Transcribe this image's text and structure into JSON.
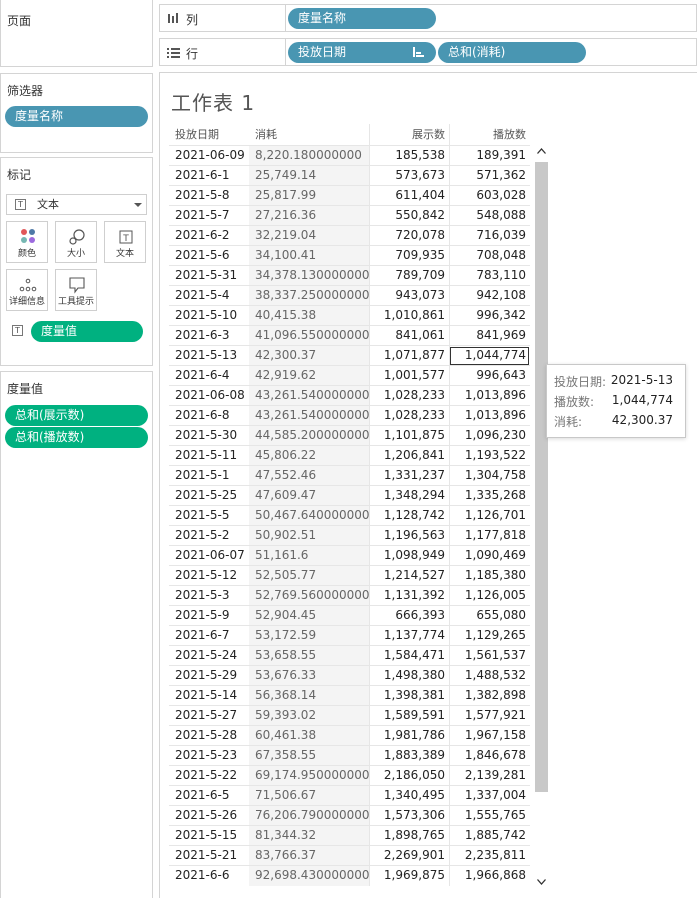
{
  "pages_panel": {
    "title": "页面"
  },
  "filters_panel": {
    "title": "筛选器",
    "pill": "度量名称"
  },
  "marks_panel": {
    "title": "标记",
    "mark_type": "文本",
    "cards": [
      {
        "label": "颜色",
        "icon": "color-dots-icon"
      },
      {
        "label": "大小",
        "icon": "size-icon"
      },
      {
        "label": "文本",
        "icon": "text-icon"
      },
      {
        "label": "详细信息",
        "icon": "detail-icon"
      },
      {
        "label": "工具提示",
        "icon": "tooltip-icon"
      }
    ],
    "text_pill": "度量值"
  },
  "measure_values_panel": {
    "title": "度量值",
    "pills": [
      "总和(展示数)",
      "总和(播放数)"
    ]
  },
  "columns_shelf": {
    "label": "列",
    "pill": "度量名称"
  },
  "rows_shelf": {
    "label": "行",
    "pills": [
      "投放日期",
      "总和(消耗)"
    ]
  },
  "sheet": {
    "title": "工作表 1",
    "headers": {
      "date": "投放日期",
      "cost": "消耗",
      "impressions": "展示数",
      "plays": "播放数"
    },
    "rows": [
      [
        "2021-06-09",
        "8,220.180000000",
        "185,538",
        "189,391"
      ],
      [
        "2021-6-1",
        "25,749.14",
        "573,673",
        "571,362"
      ],
      [
        "2021-5-8",
        "25,817.99",
        "611,404",
        "603,028"
      ],
      [
        "2021-5-7",
        "27,216.36",
        "550,842",
        "548,088"
      ],
      [
        "2021-6-2",
        "32,219.04",
        "720,078",
        "716,039"
      ],
      [
        "2021-5-6",
        "34,100.41",
        "709,935",
        "708,048"
      ],
      [
        "2021-5-31",
        "34,378.130000000",
        "789,709",
        "783,110"
      ],
      [
        "2021-5-4",
        "38,337.250000000",
        "943,073",
        "942,108"
      ],
      [
        "2021-5-10",
        "40,415.38",
        "1,010,861",
        "996,342"
      ],
      [
        "2021-6-3",
        "41,096.550000000",
        "841,061",
        "841,969"
      ],
      [
        "2021-5-13",
        "42,300.37",
        "1,071,877",
        "1,044,774"
      ],
      [
        "2021-6-4",
        "42,919.62",
        "1,001,577",
        "996,643"
      ],
      [
        "2021-06-08",
        "43,261.540000000",
        "1,028,233",
        "1,013,896"
      ],
      [
        "2021-6-8",
        "43,261.540000000",
        "1,028,233",
        "1,013,896"
      ],
      [
        "2021-5-30",
        "44,585.200000000",
        "1,101,875",
        "1,096,230"
      ],
      [
        "2021-5-11",
        "45,806.22",
        "1,206,841",
        "1,193,522"
      ],
      [
        "2021-5-1",
        "47,552.46",
        "1,331,237",
        "1,304,758"
      ],
      [
        "2021-5-25",
        "47,609.47",
        "1,348,294",
        "1,335,268"
      ],
      [
        "2021-5-5",
        "50,467.640000000",
        "1,128,742",
        "1,126,701"
      ],
      [
        "2021-5-2",
        "50,902.51",
        "1,196,563",
        "1,177,818"
      ],
      [
        "2021-06-07",
        "51,161.6",
        "1,098,949",
        "1,090,469"
      ],
      [
        "2021-5-12",
        "52,505.77",
        "1,214,527",
        "1,185,380"
      ],
      [
        "2021-5-3",
        "52,769.560000000",
        "1,131,392",
        "1,126,005"
      ],
      [
        "2021-5-9",
        "52,904.45",
        "666,393",
        "655,080"
      ],
      [
        "2021-6-7",
        "53,172.59",
        "1,137,774",
        "1,129,265"
      ],
      [
        "2021-5-24",
        "53,658.55",
        "1,584,471",
        "1,561,537"
      ],
      [
        "2021-5-29",
        "53,676.33",
        "1,498,380",
        "1,488,532"
      ],
      [
        "2021-5-14",
        "56,368.14",
        "1,398,381",
        "1,382,898"
      ],
      [
        "2021-5-27",
        "59,393.02",
        "1,589,591",
        "1,577,921"
      ],
      [
        "2021-5-28",
        "60,461.38",
        "1,981,786",
        "1,967,158"
      ],
      [
        "2021-5-23",
        "67,358.55",
        "1,883,389",
        "1,846,678"
      ],
      [
        "2021-5-22",
        "69,174.950000000",
        "2,186,050",
        "2,139,281"
      ],
      [
        "2021-6-5",
        "71,506.67",
        "1,340,495",
        "1,337,004"
      ],
      [
        "2021-5-26",
        "76,206.790000000",
        "1,573,306",
        "1,555,765"
      ],
      [
        "2021-5-15",
        "81,344.32",
        "1,898,765",
        "1,885,742"
      ],
      [
        "2021-5-21",
        "83,766.37",
        "2,269,901",
        "2,235,811"
      ],
      [
        "2021-6-6",
        "92,698.430000000",
        "1,969,875",
        "1,966,868"
      ]
    ],
    "selected_row": 10
  },
  "tooltip": {
    "rows": [
      {
        "label": "投放日期:",
        "value": "2021-5-13"
      },
      {
        "label": "播放数:",
        "value": "1,044,774"
      },
      {
        "label": "消耗:",
        "value": "42,300.37"
      }
    ]
  },
  "colors": {
    "dimension_pill": "#4996b2",
    "measure_pill": "#00b180"
  }
}
